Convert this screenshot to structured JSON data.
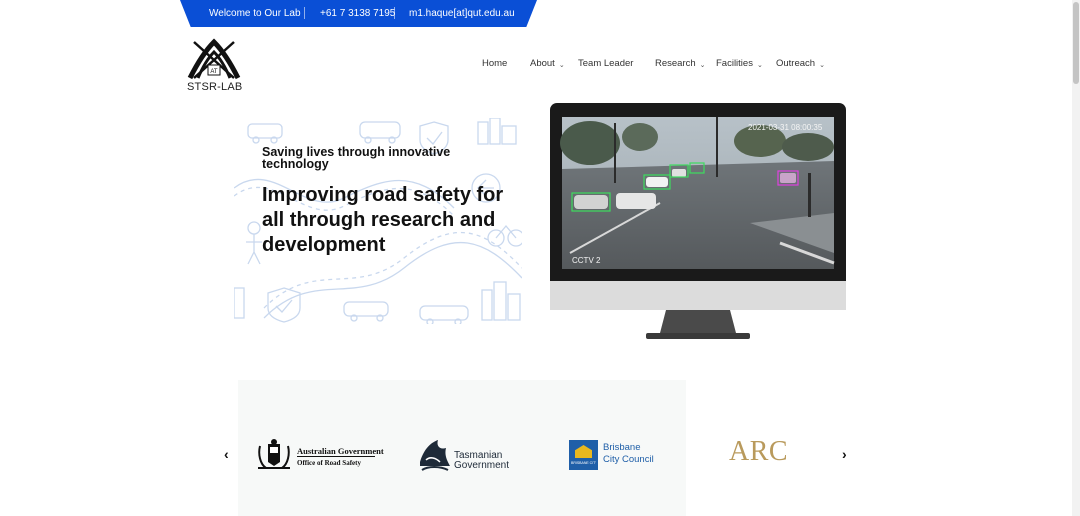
{
  "topbar": {
    "welcome": "Welcome to Our Lab",
    "phone": "+61 7 3138 7195",
    "email": "m1.haque[at]qut.edu.au",
    "color": "#0a4fd6"
  },
  "brand": {
    "logo_text": "STSR-LAB",
    "logo_badge": "AT"
  },
  "nav": {
    "items": [
      {
        "label": "Home",
        "dropdown": false
      },
      {
        "label": "About",
        "dropdown": true
      },
      {
        "label": "Team Leader",
        "dropdown": false
      },
      {
        "label": "Research",
        "dropdown": true
      },
      {
        "label": "Facilities",
        "dropdown": true
      },
      {
        "label": "Outreach",
        "dropdown": true
      }
    ]
  },
  "hero": {
    "subtitle": "Saving lives through innovative technology",
    "title": "Improving road safety for all through research and development"
  },
  "monitor": {
    "timestamp": "2021-03-31 08:00:35",
    "camera_label": "CCTV 2"
  },
  "partners": {
    "prev_icon": "chevron-left-icon",
    "next_icon": "chevron-right-icon",
    "australian_gov": {
      "line1": "Australian Government",
      "line2": "Office of Road Safety"
    },
    "tasmanian_gov": {
      "line1": "Tasmanian",
      "line2": "Government"
    },
    "brisbane": {
      "line1": "Brisbane",
      "line2": "City Council",
      "badge": "BRISBANE CITY",
      "color": "#1f5fa8"
    },
    "arc": {
      "label": "ARC",
      "color": "#b99a5c"
    }
  }
}
